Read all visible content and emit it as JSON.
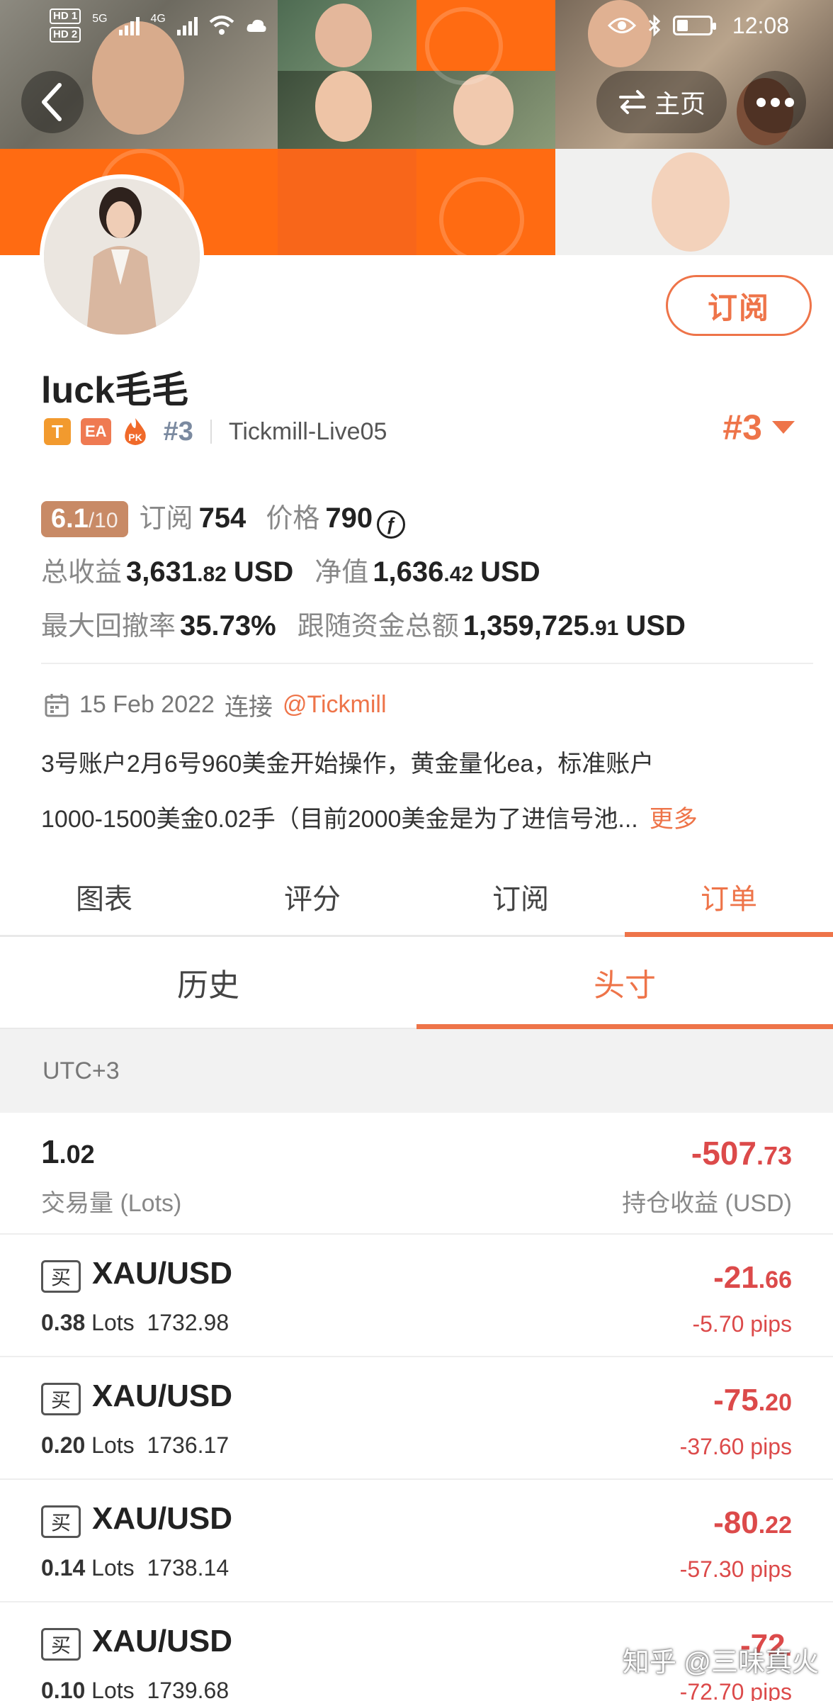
{
  "status_bar": {
    "hd1": "HD 1",
    "hd2": "HD 2",
    "net1": "5G",
    "net2": "4G",
    "time": "12:08"
  },
  "header": {
    "home_label": "主页"
  },
  "profile": {
    "name": "luck毛毛",
    "badges": [
      "T",
      "EA",
      "PK"
    ],
    "rank": "#3",
    "server": "Tickmill-Live05",
    "rank_big": "#3",
    "subscribe_label": "订阅"
  },
  "stats": {
    "score": "6.1",
    "score_max": "/10",
    "subscribers_label": "订阅",
    "subscribers": "754",
    "price_label": "价格",
    "price": "790",
    "total_profit_label": "总收益",
    "total_profit_int": "3,631",
    "total_profit_dec": ".82",
    "total_profit_unit": "USD",
    "equity_label": "净值",
    "equity_int": "1,636",
    "equity_dec": ".42",
    "equity_unit": "USD",
    "drawdown_label": "最大回撤率",
    "drawdown": "35.73%",
    "follow_funds_label": "跟随资金总额",
    "follow_funds_int": "1,359,725",
    "follow_funds_dec": ".91",
    "follow_funds_unit": "USD"
  },
  "connection": {
    "date": "15 Feb 2022",
    "connect_label": "连接",
    "broker": "@Tickmill"
  },
  "description": {
    "line1": "3号账户2月6号960美金开始操作，黄金量化ea，标准账户",
    "line2": "1000-1500美金0.02手（目前2000美金是为了进信号池...",
    "more_label": "更多"
  },
  "tabs": [
    {
      "label": "图表",
      "active": false
    },
    {
      "label": "评分",
      "active": false
    },
    {
      "label": "订阅",
      "active": false
    },
    {
      "label": "订单",
      "active": true
    }
  ],
  "subtabs": [
    {
      "label": "历史",
      "active": false
    },
    {
      "label": "头寸",
      "active": true
    }
  ],
  "timezone": "UTC+3",
  "summary": {
    "lots_int": "1",
    "lots_dec": ".02",
    "lots_label": "交易量 (Lots)",
    "pl_int": "-507",
    "pl_dec": ".73",
    "pl_label": "持仓收益 (USD)"
  },
  "positions": [
    {
      "side": "买",
      "symbol": "XAU/USD",
      "lots": "0.38",
      "lots_unit": "Lots",
      "price": "1732.98",
      "profit_int": "-21",
      "profit_dec": ".66",
      "pips": "-5.70 pips"
    },
    {
      "side": "买",
      "symbol": "XAU/USD",
      "lots": "0.20",
      "lots_unit": "Lots",
      "price": "1736.17",
      "profit_int": "-75",
      "profit_dec": ".20",
      "pips": "-37.60 pips"
    },
    {
      "side": "买",
      "symbol": "XAU/USD",
      "lots": "0.14",
      "lots_unit": "Lots",
      "price": "1738.14",
      "profit_int": "-80",
      "profit_dec": ".22",
      "pips": "-57.30 pips"
    },
    {
      "side": "买",
      "symbol": "XAU/USD",
      "lots": "0.10",
      "lots_unit": "Lots",
      "price": "1739.68",
      "profit_int": "-72",
      "profit_dec": ".",
      "pips": "-72.70 pips"
    }
  ],
  "watermark": "知乎 @三味真火",
  "colors": {
    "accent": "#ee7449",
    "negative": "#dc4a4a",
    "banner_orange": "#ff6b12"
  }
}
